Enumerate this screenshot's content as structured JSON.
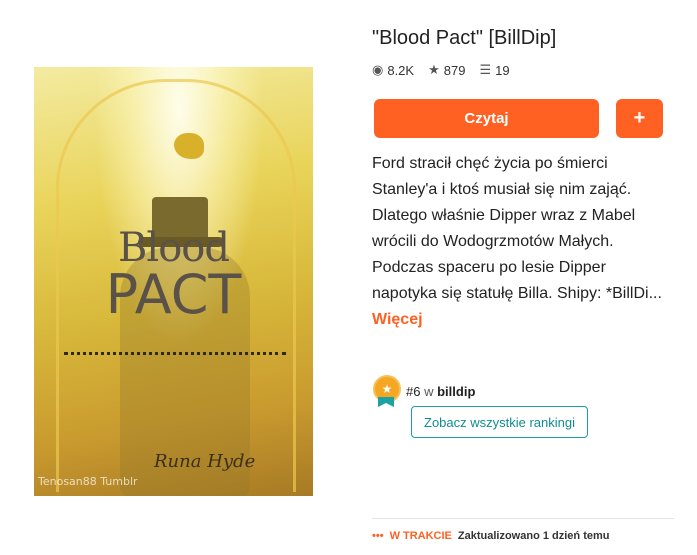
{
  "story": {
    "title": "\"Blood Pact\" [BillDip]",
    "stats": {
      "reads": "8.2K",
      "votes": "879",
      "parts": "19"
    },
    "read_button": "Czytaj",
    "add_button": "+",
    "description": "Ford stracił chęć życia po śmierci Stanley'a i ktoś musiał się nim zająć. Dlatego właśnie Dipper wraz z Mabel wrócili do Wodogrzmotów Małych. Podczas spaceru po lesie Dipper napotyka się statułę Billa. Shipy: *BillDi...",
    "more_link": "Więcej"
  },
  "cover": {
    "title_line1": "Blood",
    "title_line2": "PACT",
    "signature": "Runa Hyde",
    "watermark": "Tenosan88 Tumblr"
  },
  "ranking": {
    "position": "#6",
    "in": "w",
    "tag": "billdip",
    "link": "Zobacz wszystkie rankingi"
  },
  "status": {
    "state": "W TRAKCIE",
    "updated": "Zaktualizowano 1 dzień temu"
  },
  "icons": {
    "reads": "eye-icon",
    "votes": "star-icon",
    "parts": "list-icon",
    "ranking": "medal-icon"
  },
  "colors": {
    "accent": "#ff6122",
    "teal": "#1a9ea0"
  }
}
